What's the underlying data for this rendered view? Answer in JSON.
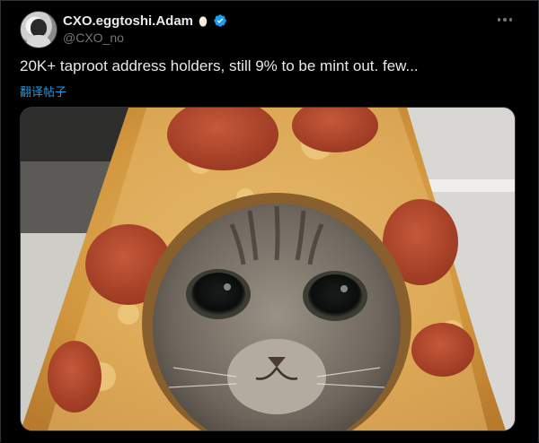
{
  "author": {
    "display_name": "CXO.eggtoshi.Adam",
    "handle": "@CXO_no",
    "name_emoji": "egg-icon",
    "verified": true,
    "verified_color": "#1d9bf0"
  },
  "menu": {
    "icon": "more-horizontal-icon"
  },
  "tweet": {
    "text": "20K+ taproot address holders, still 9% to be mint out. few...",
    "translate_label": "翻译帖子"
  },
  "media": {
    "icon": "cat-in-pizza-slice-photo"
  },
  "colors": {
    "background": "#000000",
    "text": "#e7e9ea",
    "secondary": "#71767b",
    "link": "#1d9bf0",
    "border": "#2f3336"
  }
}
